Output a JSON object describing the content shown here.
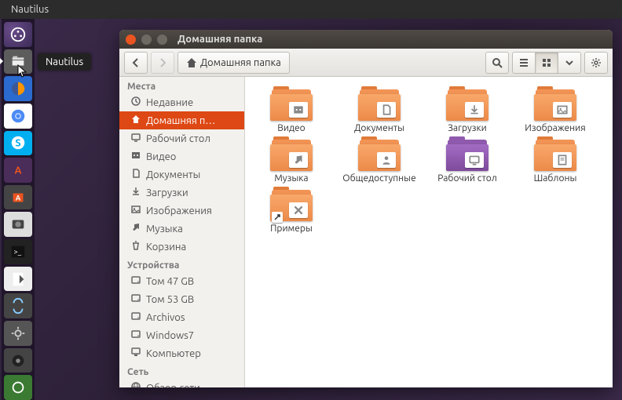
{
  "menubar": {
    "app": "Nautilus"
  },
  "launcher": {
    "tooltip": "Nautilus",
    "items": [
      {
        "name": "dash",
        "cls": "li-dash"
      },
      {
        "name": "files",
        "cls": "li-files",
        "active": true
      },
      {
        "name": "firefox",
        "cls": "li-fx"
      },
      {
        "name": "chromium",
        "cls": "li-chrom"
      },
      {
        "name": "skype",
        "cls": "li-skype"
      },
      {
        "name": "software-updater",
        "cls": "li-update"
      },
      {
        "name": "software-center",
        "cls": "li-sc"
      },
      {
        "name": "screenshot",
        "cls": "li-scr"
      },
      {
        "name": "terminal",
        "cls": "li-term"
      },
      {
        "name": "text-editor",
        "cls": "li-edit"
      },
      {
        "name": "sync",
        "cls": "li-sync"
      },
      {
        "name": "settings-1",
        "cls": "li-set1"
      },
      {
        "name": "settings-2",
        "cls": "li-set2"
      },
      {
        "name": "control",
        "cls": "li-ctl"
      }
    ]
  },
  "window": {
    "title": "Домашняя папка",
    "path_label": "Домашняя папка"
  },
  "sidebar": {
    "sections": [
      {
        "title": "Места",
        "items": [
          {
            "icon": "clock",
            "label": "Недавние"
          },
          {
            "icon": "home",
            "label": "Домашняя п…",
            "selected": true
          },
          {
            "icon": "desktop",
            "label": "Рабочий стол"
          },
          {
            "icon": "video",
            "label": "Видео"
          },
          {
            "icon": "document",
            "label": "Документы"
          },
          {
            "icon": "download",
            "label": "Загрузки"
          },
          {
            "icon": "image",
            "label": "Изображения"
          },
          {
            "icon": "music",
            "label": "Музыка"
          },
          {
            "icon": "trash",
            "label": "Корзина"
          }
        ]
      },
      {
        "title": "Устройства",
        "items": [
          {
            "icon": "disk",
            "label": "Том 47 GB"
          },
          {
            "icon": "disk",
            "label": "Том 53 GB"
          },
          {
            "icon": "disk",
            "label": "Archivos"
          },
          {
            "icon": "disk",
            "label": "Windows7"
          },
          {
            "icon": "computer",
            "label": "Компьютер"
          }
        ]
      },
      {
        "title": "Сеть",
        "items": [
          {
            "icon": "network",
            "label": "Обзор сети"
          }
        ]
      }
    ]
  },
  "folders": [
    {
      "label": "Видео",
      "badge": "video"
    },
    {
      "label": "Документы",
      "badge": "document"
    },
    {
      "label": "Загрузки",
      "badge": "download"
    },
    {
      "label": "Изображения",
      "badge": "image"
    },
    {
      "label": "Музыка",
      "badge": "music"
    },
    {
      "label": "Общедоступные",
      "badge": "public"
    },
    {
      "label": "Рабочий стол",
      "badge": "desktop",
      "purple": true
    },
    {
      "label": "Шаблоны",
      "badge": "template"
    },
    {
      "label": "Примеры",
      "badge": "examples",
      "emblem": true
    }
  ]
}
